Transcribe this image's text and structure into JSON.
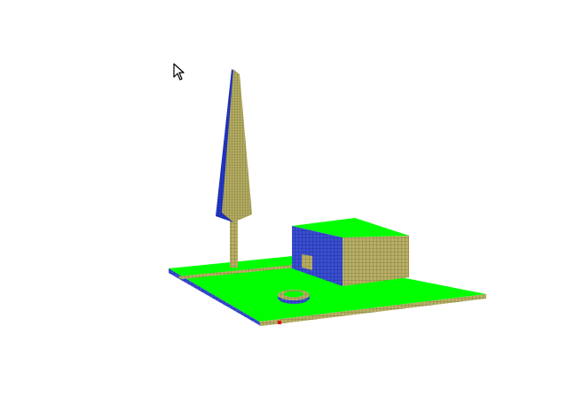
{
  "scene": {
    "background": "#ffffff",
    "colors": {
      "grass": "#00ff00",
      "wall_olive": "#b8ae66",
      "wall_blue": "#3a4fd0",
      "grid_line_olive": "#7f7a3d",
      "grid_line_blue": "#1a2a9a",
      "trunk": "#9c9a55",
      "tree_blue": "#2438c4",
      "tree_olive": "#b4ad62",
      "marker_red": "#e01010",
      "cursor_fill": "#ffffff",
      "cursor_stroke": "#000000"
    },
    "objects": [
      "ground-plane",
      "ground-front-edge",
      "ground-left-edge",
      "ground-center-seam",
      "block-building",
      "building-doorway",
      "well-ring",
      "tall-tree",
      "red-marker"
    ]
  },
  "cursor": {
    "icon": "mouse-pointer-icon"
  }
}
